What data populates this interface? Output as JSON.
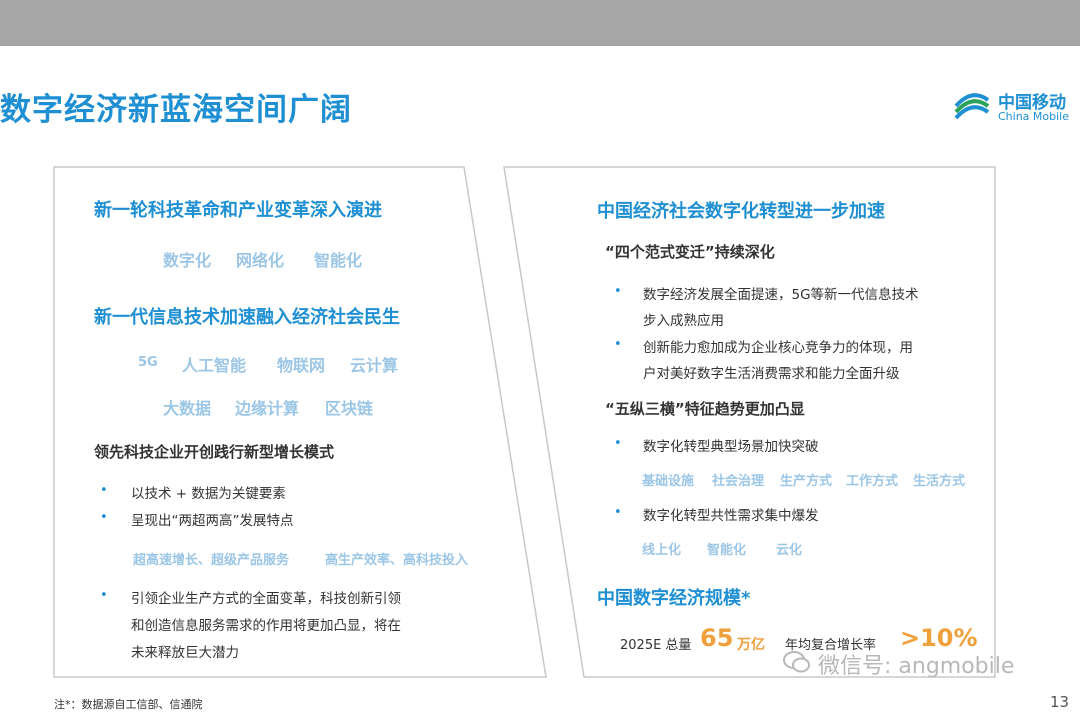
{
  "header": {
    "title": "数字经济新蓝海空间广阔"
  },
  "logo": {
    "cn": "中国移动",
    "en": "China Mobile"
  },
  "left_panel": {
    "heading1": "新一轮科技革命和产业变革深入演进",
    "keywords1": [
      "数字化",
      "网络化",
      "智能化"
    ],
    "heading2": "新一代信息技术加速融入经济社会民生",
    "tech_row1": [
      "5G",
      "人工智能",
      "物联网",
      "云计算"
    ],
    "tech_row2": [
      "大数据",
      "边缘计算",
      "区块链"
    ],
    "subheading": "领先科技企业开创践行新型增长模式",
    "bullets": [
      "以技术 + 数据为关键要素",
      "呈现出“两超两高”发展特点"
    ],
    "features": [
      "超高速增长、超级产品服务",
      "高生产效率、高科技投入"
    ],
    "bullet3_lines": [
      "引领企业生产方式的全面变革，科技创新引领",
      "和创造信息服务需求的作用将更加凸显，将在",
      "未来释放巨大潜力"
    ]
  },
  "right_panel": {
    "heading": "中国经济社会数字化转型进一步加速",
    "sub1": "“四个范式变迁”持续深化",
    "bullet1_lines": [
      "数字经济发展全面提速，5G等新一代信息技术",
      "步入成熟应用"
    ],
    "bullet2_lines": [
      "创新能力愈加成为企业核心竞争力的体现，用",
      "户对美好数字生活消费需求和能力全面升级"
    ],
    "sub2": "“五纵三横”特征趋势更加凸显",
    "bullet3": "数字化转型典型场景加快突破",
    "scenarios": [
      "基础设施",
      "社会治理",
      "生产方式",
      "工作方式",
      "生活方式"
    ],
    "bullet4": "数字化转型共性需求集中爆发",
    "demands": [
      "线上化",
      "智能化",
      "云化"
    ],
    "scale_heading": "中国数字经济规模*",
    "scale_prefix": "2025E 总量",
    "scale_value": "65",
    "scale_unit": "万亿",
    "scale_growth_label": "年均复合增长率",
    "scale_growth_value": ">10%"
  },
  "footer": {
    "note": "注*：数据源自工信部、信通院",
    "page_number": "13",
    "watermark": "微信号: angmobile"
  },
  "colors": {
    "brand_blue": "#1f8fd3",
    "keyword_blue": "#9cc6e6",
    "accent_orange": "#f0a03a",
    "topbar_gray": "#a6a6a6"
  }
}
